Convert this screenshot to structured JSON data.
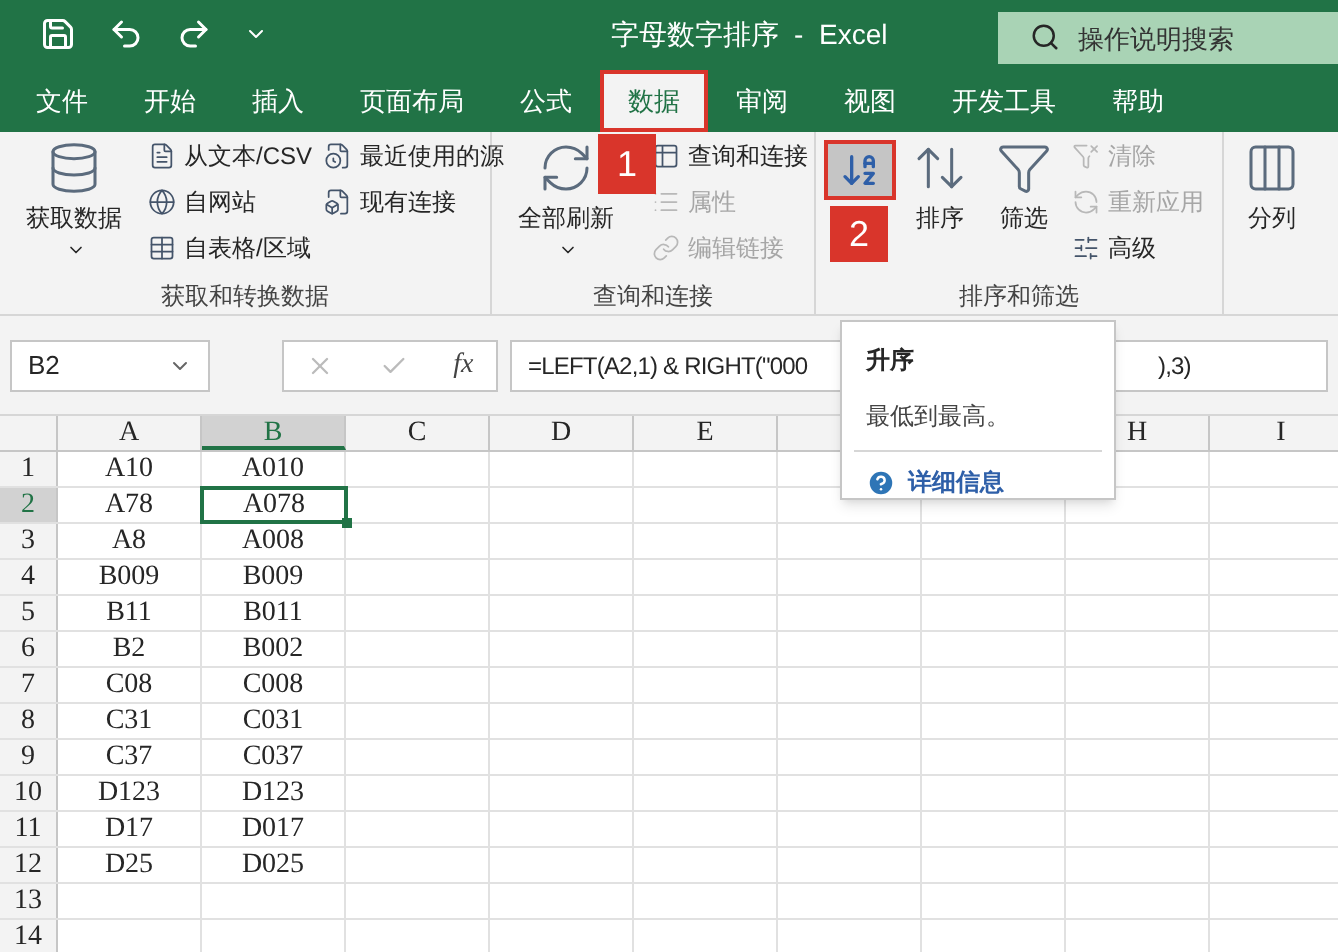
{
  "title_bar": {
    "title": "字母数字排序  -  Excel",
    "search": {
      "placeholder": "操作说明搜索"
    }
  },
  "tabs": [
    {
      "label": "文件",
      "selected": false,
      "outlined": false
    },
    {
      "label": "开始",
      "selected": false,
      "outlined": false
    },
    {
      "label": "插入",
      "selected": false,
      "outlined": false
    },
    {
      "label": "页面布局",
      "selected": false,
      "outlined": false
    },
    {
      "label": "公式",
      "selected": false,
      "outlined": false
    },
    {
      "label": "数据",
      "selected": true,
      "outlined": true
    },
    {
      "label": "审阅",
      "selected": false,
      "outlined": false
    },
    {
      "label": "视图",
      "selected": false,
      "outlined": false
    },
    {
      "label": "开发工具",
      "selected": false,
      "outlined": false
    },
    {
      "label": "帮助",
      "selected": false,
      "outlined": false
    }
  ],
  "ribbon": {
    "groups": [
      {
        "label": "获取和转换数据",
        "columns": [
          [
            {
              "kind": "large",
              "label": "获取数据",
              "dropdown": true,
              "disabled": false
            }
          ],
          [
            {
              "kind": "small",
              "label": "从文本/CSV",
              "disabled": false
            },
            {
              "kind": "small",
              "label": "自网站",
              "disabled": false
            },
            {
              "kind": "small",
              "label": "自表格/区域",
              "disabled": false
            }
          ],
          [
            {
              "kind": "small",
              "label": "最近使用的源",
              "disabled": false
            },
            {
              "kind": "small",
              "label": "现有连接",
              "disabled": false
            }
          ]
        ]
      },
      {
        "label": "查询和连接",
        "columns": [
          [
            {
              "kind": "large",
              "label": "全部刷新",
              "dropdown": true,
              "disabled": false
            }
          ],
          [
            {
              "kind": "small",
              "label": "查询和连接",
              "disabled": false
            },
            {
              "kind": "small",
              "label": "属性",
              "disabled": true
            },
            {
              "kind": "small",
              "label": "编辑链接",
              "disabled": true
            }
          ]
        ]
      },
      {
        "label": "排序和筛选",
        "columns": [
          [
            {
              "kind": "icon",
              "hovered": true,
              "outlined": true
            }
          ],
          [
            {
              "kind": "large",
              "label": "排序",
              "dropdown": false,
              "disabled": false
            }
          ],
          [
            {
              "kind": "large",
              "label": "筛选",
              "dropdown": false,
              "disabled": false
            }
          ],
          [
            {
              "kind": "small",
              "label": "清除",
              "disabled": true
            },
            {
              "kind": "small",
              "label": "重新应用",
              "disabled": true
            },
            {
              "kind": "small",
              "label": "高级",
              "disabled": false
            }
          ]
        ]
      },
      {
        "columns": [
          [
            {
              "kind": "large",
              "label": "分列",
              "dropdown": false,
              "disabled": false
            }
          ]
        ]
      }
    ]
  },
  "callouts": [
    "1",
    "2"
  ],
  "formula_bar": {
    "name_box": "B2",
    "fx": "fx",
    "formula": [
      "=LEFT(A2,1) & RIGHT(\"000",
      "),3)"
    ]
  },
  "tooltip": {
    "title": "升序",
    "text": "最低到最高。",
    "link": "详细信息"
  },
  "grid": {
    "columns": [
      {
        "label": "A",
        "selected": false
      },
      {
        "label": "B",
        "selected": true
      },
      {
        "label": "C",
        "selected": false
      },
      {
        "label": "D",
        "selected": false
      },
      {
        "label": "E",
        "selected": false
      },
      {
        "label": "H",
        "selected": false
      },
      {
        "label": "I",
        "selected": false
      }
    ],
    "rows": [
      {
        "label": "1",
        "selected": false,
        "cells": [
          {
            "value": "A10",
            "selected": false
          },
          {
            "value": "A010",
            "selected": false
          }
        ]
      },
      {
        "label": "2",
        "selected": true,
        "cells": [
          {
            "value": "A78",
            "selected": false
          },
          {
            "value": "A078",
            "selected": true
          }
        ]
      },
      {
        "label": "3",
        "selected": false,
        "cells": [
          {
            "value": "A8",
            "selected": false
          },
          {
            "value": "A008",
            "selected": false
          }
        ]
      },
      {
        "label": "4",
        "selected": false,
        "cells": [
          {
            "value": "B009",
            "selected": false
          },
          {
            "value": "B009",
            "selected": false
          }
        ]
      },
      {
        "label": "5",
        "selected": false,
        "cells": [
          {
            "value": "B11",
            "selected": false
          },
          {
            "value": "B011",
            "selected": false
          }
        ]
      },
      {
        "label": "6",
        "selected": false,
        "cells": [
          {
            "value": "B2",
            "selected": false
          },
          {
            "value": "B002",
            "selected": false
          }
        ]
      },
      {
        "label": "7",
        "selected": false,
        "cells": [
          {
            "value": "C08",
            "selected": false
          },
          {
            "value": "C008",
            "selected": false
          }
        ]
      },
      {
        "label": "8",
        "selected": false,
        "cells": [
          {
            "value": "C31",
            "selected": false
          },
          {
            "value": "C031",
            "selected": false
          }
        ]
      },
      {
        "label": "9",
        "selected": false,
        "cells": [
          {
            "value": "C37",
            "selected": false
          },
          {
            "value": "C037",
            "selected": false
          }
        ]
      },
      {
        "label": "10",
        "selected": false,
        "cells": [
          {
            "value": "D123",
            "selected": false
          },
          {
            "value": "D123",
            "selected": false
          }
        ]
      },
      {
        "label": "11",
        "selected": false,
        "cells": [
          {
            "value": "D17",
            "selected": false
          },
          {
            "value": "D017",
            "selected": false
          }
        ]
      },
      {
        "label": "12",
        "selected": false,
        "cells": [
          {
            "value": "D25",
            "selected": false
          },
          {
            "value": "D025",
            "selected": false
          }
        ]
      },
      {
        "label": "13",
        "selected": false,
        "cells": []
      },
      {
        "label": "14",
        "selected": false,
        "cells": []
      }
    ]
  }
}
